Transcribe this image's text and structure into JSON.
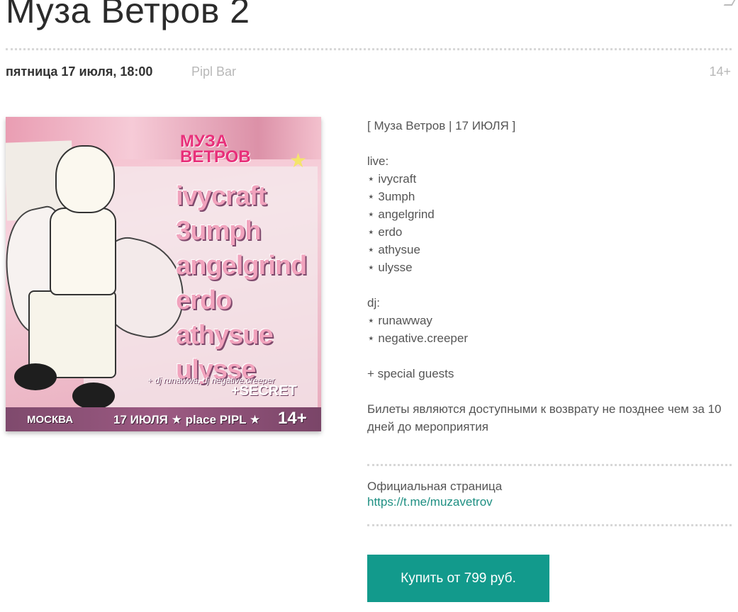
{
  "event": {
    "title": "Муза Ветров 2",
    "date": "пятница 17 июля, 18:00",
    "venue": "Pipl Bar",
    "age": "14+"
  },
  "poster": {
    "logo_line1": "МУЗА",
    "logo_line2": "ВЕТРОВ",
    "acts": [
      "ivycraft",
      "3umph",
      "angelgrind",
      "erdo",
      "athysue",
      "ulysse"
    ],
    "dj_line": "+ dj runawwa, dj negative.creeper",
    "secret": "+SECRET",
    "city": "МОСКВА",
    "bottom_info": "17 ИЮЛЯ ★ place PIPL ★",
    "age": "14+"
  },
  "description": {
    "header": "[ Муза Ветров | 17 ИЮЛЯ ]",
    "live_label": "live:",
    "live": [
      "⋆ ivycraft",
      "⋆ 3umph",
      "⋆ angelgrind",
      "⋆ erdo",
      "⋆ athysue",
      "⋆ ulysse"
    ],
    "dj_label": "dj:",
    "dj": [
      "⋆ runawway",
      "⋆ negative.creeper"
    ],
    "guests": "+ special guests",
    "refund": "Билеты являются доступными к возврату не позднее чем за 10 дней до мероприятия"
  },
  "official": {
    "label": "Официальная страница",
    "link": "https://t.me/muzavetrov"
  },
  "buy": {
    "label": "Купить от 799 руб."
  },
  "colors": {
    "accent": "#129a8c",
    "link": "#1e8f82",
    "muted": "#b8b8b8"
  }
}
